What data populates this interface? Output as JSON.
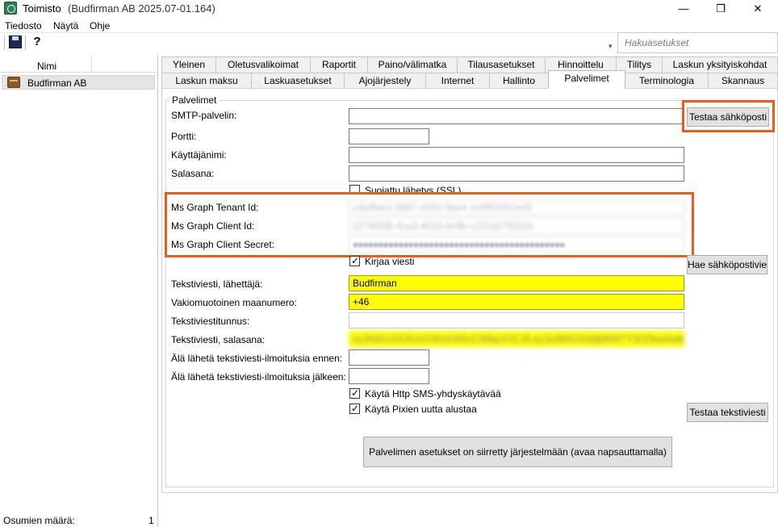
{
  "window": {
    "title": "Toimisto",
    "subtitle": "(Budfirman AB 2025.07-01.164)",
    "minimize": "—",
    "restore": "❐",
    "close": "✕"
  },
  "menu": [
    "Tiedosto",
    "Näytä",
    "Ohje"
  ],
  "toolbar": {
    "search_placeholder": "Hakuasetukset",
    "help_glyph": "?"
  },
  "left_panel": {
    "column_header": "Nimi",
    "items": [
      {
        "label": "Budfirman AB"
      }
    ],
    "status_label": "Osumien määrä:",
    "status_count": "1"
  },
  "tabs_row1": [
    "Yleinen",
    "Oletusvalikoimat",
    "Raportit",
    "Paino/välimatka",
    "Tilausasetukset",
    "Hinnoittelu",
    "Tilitys",
    "Laskun yksityiskohdat"
  ],
  "tabs_row2": [
    "Laskun maksu",
    "Laskuasetukset",
    "Ajojärjestely",
    "Internet",
    "Hallinto",
    "Palvelimet",
    "Terminologia",
    "Skannaus"
  ],
  "active_tab": "Palvelimet",
  "form": {
    "group_title": "Palvelimet",
    "smtp_label": "SMTP-palvelin:",
    "smtp_value": "",
    "test_email_button": "Testaa sähköposti",
    "port_label": "Portti:",
    "port_value": "",
    "username_label": "Käyttäjänimi:",
    "username_value": "",
    "password_label": "Salasana:",
    "password_value": "",
    "ssl_label": "Suojattu lähetys (SSL)",
    "tenant_label": "Ms Graph Tenant Id:",
    "tenant_value": "c4a9fae1-5887-4282-9ae4-1e89f1051ed3",
    "client_label": "Ms Graph Client Id:",
    "client_value": "227465fb-4ca3-4618-be9b-c131a279310e",
    "secret_label": "Ms Graph Client Secret:",
    "secret_value": "●●●●●●●●●●●●●●●●●●●●●●●●●●●●●●●●●●●●●●●●●●",
    "log_email_label": "Kirjaa viesti",
    "fetch_email_button": "Hae sähköpostivie",
    "sms_sender_label": "Tekstiviesti, lähettäjä:",
    "sms_sender_value": "Budfirman",
    "country_code_label": "Vakiomuotoinen maanumero:",
    "country_code_value": "+46",
    "sms_id_label": "Tekstiviestitunnus:",
    "sms_id_value": "",
    "sms_password_label": "Tekstiviesti, salasana:",
    "sms_password_value": "eyJhbGciOiJIUzI1NiIsInR5cCI6IkpXVCJ9.eyJzdWIiOiIxMjM0NTY3ODkwIiwibmFtZSI6",
    "no_sms_before_label": "Älä lähetä tekstiviesti-ilmoituksia ennen:",
    "no_sms_before_value": "",
    "no_sms_after_label": "Älä lähetä tekstiviesti-ilmoituksia jälkeen:",
    "no_sms_after_value": "",
    "http_sms_label": "Käytä Http SMS-yhdyskäytävää",
    "pixie_label": "Käytä Pixien uutta alustaa",
    "test_sms_button": "Testaa tekstiviesti",
    "server_moved_button": "Palvelimen asetukset on siirretty järjestelmään (avaa napsauttamalla)"
  },
  "colors": {
    "highlight": "#f05a1a",
    "yellow_field": "#ffff00"
  }
}
